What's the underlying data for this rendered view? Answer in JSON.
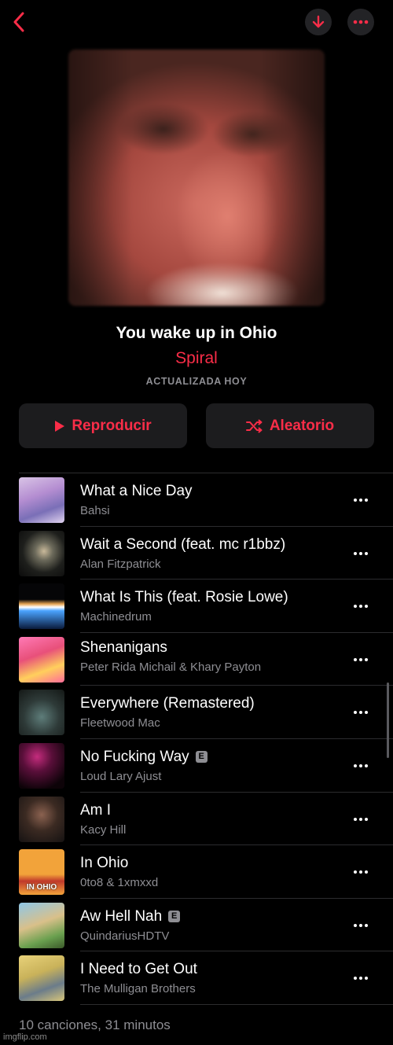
{
  "header": {
    "back_icon": "chevron-left-icon",
    "download_icon": "arrow-down-icon",
    "more_icon": "ellipsis-icon",
    "accent_color": "#fa2d48"
  },
  "playlist": {
    "title": "You wake up in Ohio",
    "artist": "Spiral",
    "updated": "ACTUALIZADA HOY"
  },
  "actions": {
    "play_label": "Reproducir",
    "shuffle_label": "Aleatorio"
  },
  "tracks": [
    {
      "title": "What a Nice Day",
      "artist": "Bahsi",
      "explicit": false
    },
    {
      "title": "Wait a Second (feat. mc r1bbz)",
      "artist": "Alan Fitzpatrick",
      "explicit": false
    },
    {
      "title": "What Is This (feat. Rosie Lowe)",
      "artist": "Machinedrum",
      "explicit": false
    },
    {
      "title": "Shenanigans",
      "artist": "Peter Rida Michail & Khary Payton",
      "explicit": false
    },
    {
      "title": "Everywhere (Remastered)",
      "artist": "Fleetwood Mac",
      "explicit": false
    },
    {
      "title": "No Fucking Way",
      "artist": "Loud Lary Ajust",
      "explicit": true
    },
    {
      "title": "Am I",
      "artist": "Kacy Hill",
      "explicit": false
    },
    {
      "title": "In Ohio",
      "artist": "0to8 & 1xmxxd",
      "explicit": false
    },
    {
      "title": "Aw Hell Nah",
      "artist": "QuindariusHDTV",
      "explicit": true
    },
    {
      "title": "I Need to Get Out",
      "artist": "The Mulligan Brothers",
      "explicit": false
    }
  ],
  "art_labels": {
    "in_ohio": "IN OHIO"
  },
  "explicit_badge": "E",
  "footer": {
    "summary": "10 canciones, 31 minutos"
  },
  "watermark": "imgflip.com"
}
